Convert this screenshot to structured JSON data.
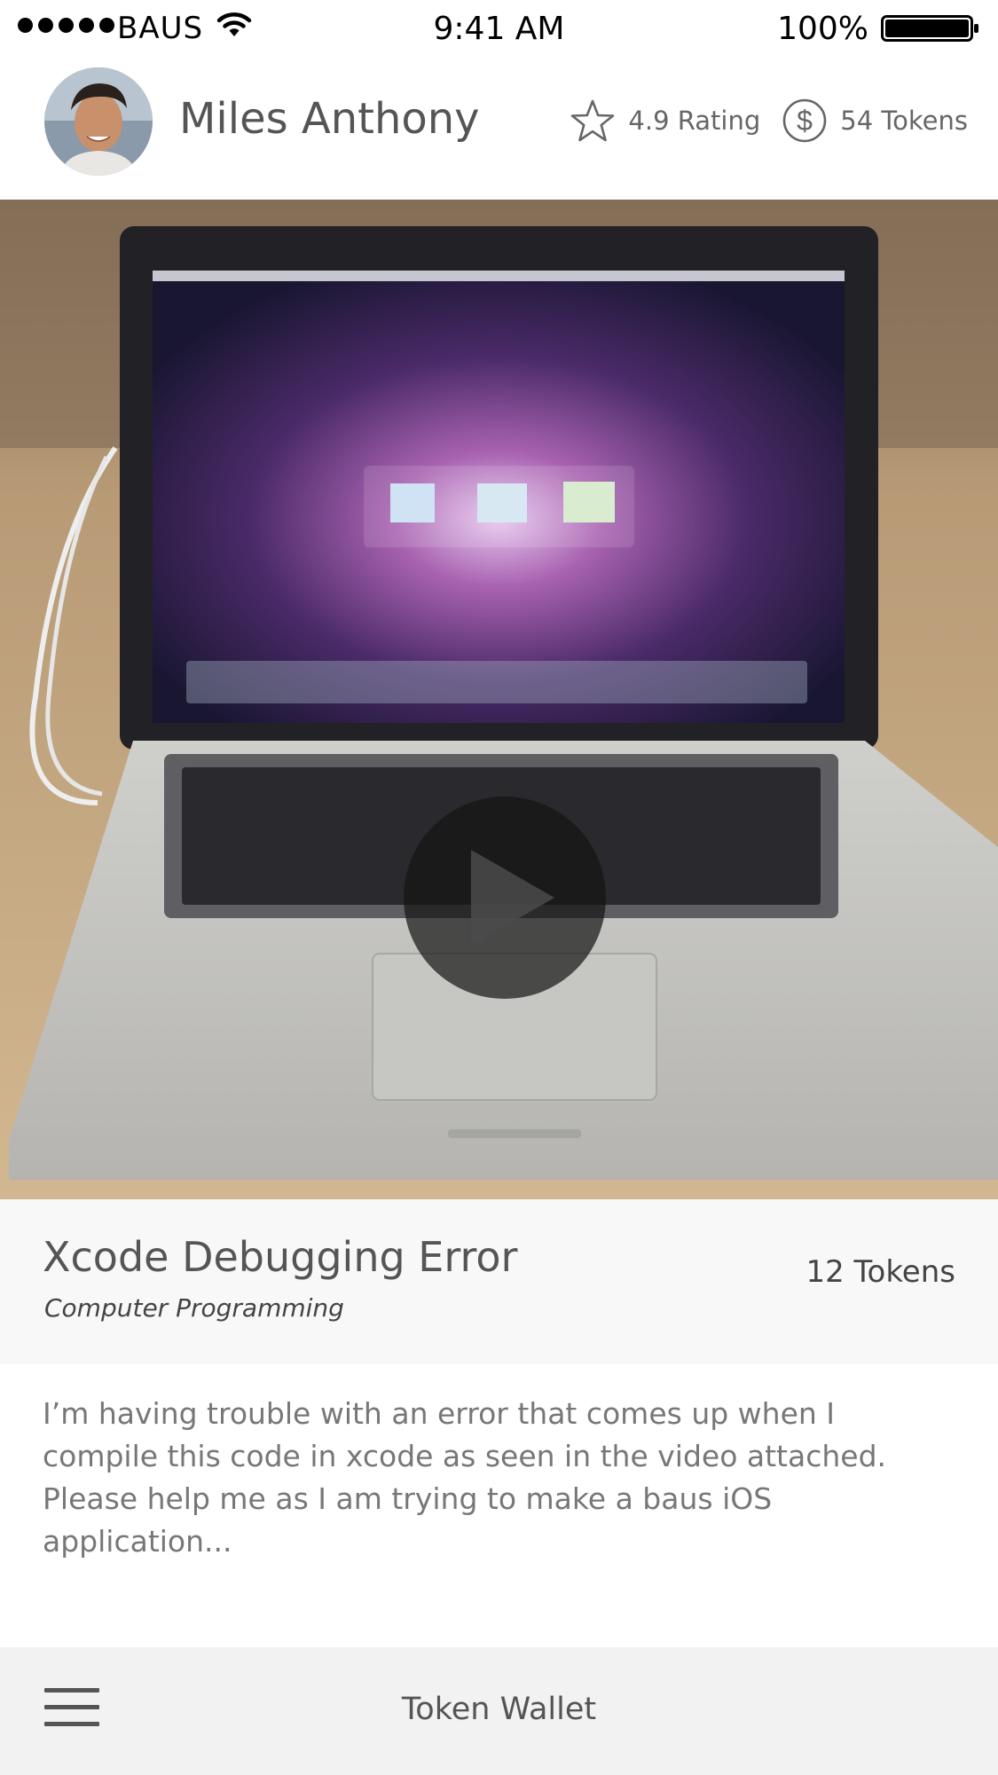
{
  "status_bar": {
    "carrier": "BAUS",
    "time": "9:41 AM",
    "battery": "100%"
  },
  "profile": {
    "name": "Miles Anthony",
    "rating": "4.9 Rating",
    "tokens": "54 Tokens",
    "icons": [
      "star-icon",
      "dollar-circle-icon"
    ]
  },
  "video": {
    "description": "Video thumbnail of a laptop",
    "play_icon": "play-icon"
  },
  "post": {
    "title": "Xcode Debugging Error",
    "category": "Computer Programming",
    "tokens": "12 Tokens",
    "description": "I’m having trouble with an error that comes up when I compile this code in xcode as seen in the video attached. Please help me as I am trying to make a baus iOS application..."
  },
  "tab_bar": {
    "title": "Token Wallet",
    "menu_icon": "hamburger-menu-icon"
  }
}
